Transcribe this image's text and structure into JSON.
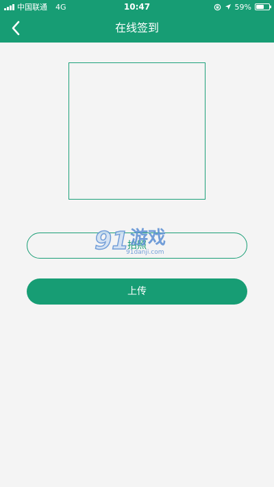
{
  "status_bar": {
    "carrier": "中国联通",
    "network": "4G",
    "time": "10:47",
    "battery_percent": "59%",
    "battery_level": 0.59
  },
  "nav": {
    "title": "在线签到",
    "back_icon": "chevron-left-icon"
  },
  "actions": {
    "photo_label": "拍照",
    "upload_label": "上传"
  },
  "watermark": {
    "number": "91",
    "text": "游戏",
    "url": "91danji.com"
  },
  "colors": {
    "primary": "#179d74",
    "background": "#f4f4f4",
    "watermark": "#5b8fd4"
  }
}
